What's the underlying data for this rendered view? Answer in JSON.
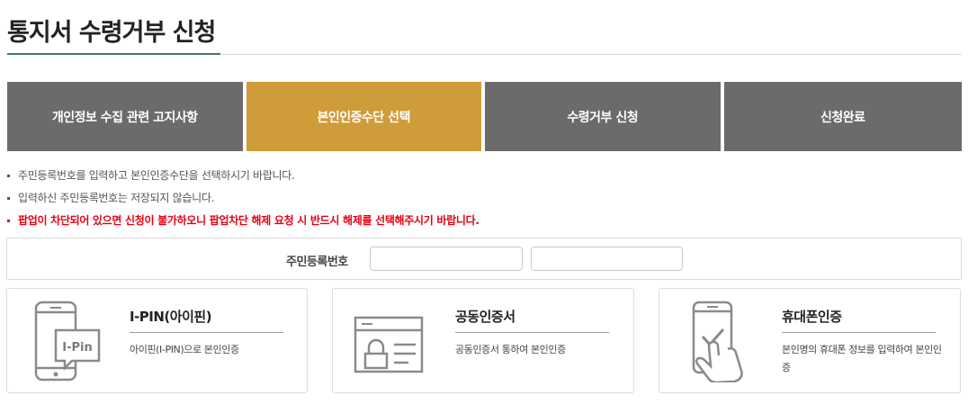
{
  "page": {
    "title": "통지서 수령거부 신청"
  },
  "steps": [
    {
      "label": "개인정보 수집 관련 고지사항",
      "active": false
    },
    {
      "label": "본인인증수단 선택",
      "active": true
    },
    {
      "label": "수령거부 신청",
      "active": false
    },
    {
      "label": "신청완료",
      "active": false
    }
  ],
  "notices": [
    "주민등록번호를 입력하고 본인인증수단을 선택하시기 바랍니다.",
    "입력하신 주민등록번호는 저장되지 않습니다.",
    "팝업이 차단되어 있으면 신청이 불가하오니 팝업차단 해제 요청 시 반드시 해제를 선택해주시기 바랍니다."
  ],
  "rrn": {
    "label": "주민등록번호",
    "value_front": "",
    "value_back": ""
  },
  "cards": [
    {
      "title": "I-PIN(아이핀)",
      "description": "아이핀(I-PIN)으로 본인인증",
      "icon": "ipin-phone-icon",
      "icon_text": "I-Pin"
    },
    {
      "title": "공동인증서",
      "description": "공동인증서 통하여 본인인증",
      "icon": "certificate-lock-icon"
    },
    {
      "title": "휴대폰인증",
      "description": "본인명의 휴대폰 정보를 입력하여 본인인증",
      "icon": "phone-check-icon"
    }
  ],
  "colors": {
    "active_step": "#cf9c3a",
    "inactive_step": "#6b6b6b",
    "warning": "#e60012",
    "title_accent": "#3e7b6b",
    "icon_stroke": "#8a8a8a"
  }
}
